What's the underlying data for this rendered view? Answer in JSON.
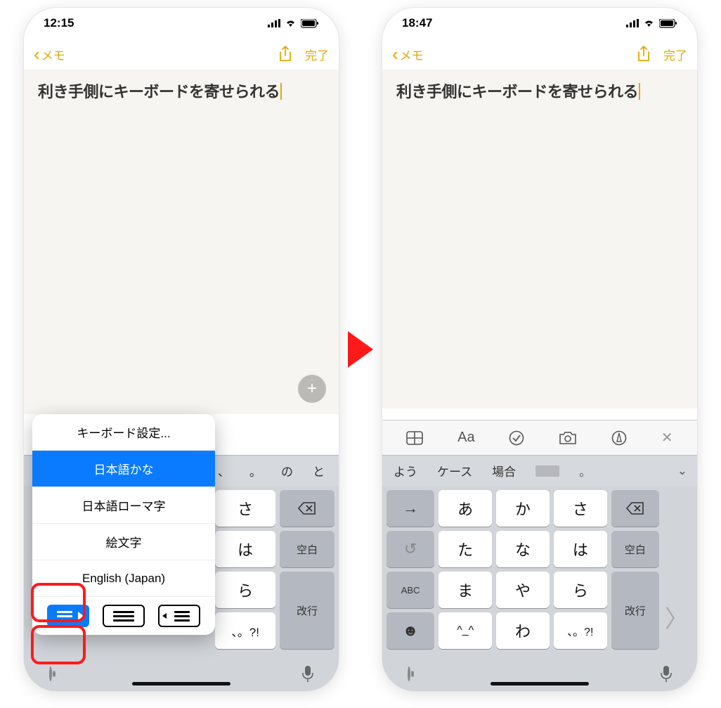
{
  "left": {
    "status": {
      "time": "12:15"
    },
    "nav": {
      "back": "メモ",
      "done": "完了"
    },
    "note": {
      "title": "利き手側にキーボードを寄せられる"
    },
    "popup": {
      "settings": "キーボード設定...",
      "items": [
        "日本語かな",
        "日本語ローマ字",
        "絵文字",
        "English (Japan)"
      ],
      "selected_index": 0
    },
    "suggestions": [
      "、",
      "。",
      "の",
      "と"
    ],
    "kb": {
      "rows": [
        [
          "さ"
        ],
        [
          "は"
        ],
        [
          "ら"
        ],
        [
          "、。?!"
        ]
      ],
      "space": "空白",
      "return": "改行"
    }
  },
  "right": {
    "status": {
      "time": "18:47"
    },
    "nav": {
      "back": "メモ",
      "done": "完了"
    },
    "note": {
      "title": "利き手側にキーボードを寄せられる"
    },
    "toolbar": {
      "aa": "Aa"
    },
    "suggestions": [
      "よう",
      "ケース",
      "場合"
    ],
    "kb": {
      "rows": [
        [
          "→",
          "あ",
          "か",
          "さ",
          "⌫"
        ],
        [
          "↺",
          "た",
          "な",
          "は",
          "空白"
        ],
        [
          "ABC",
          "ま",
          "や",
          "ら",
          "改行"
        ],
        [
          "☻",
          "^_^",
          "わ",
          "、。?!"
        ]
      ],
      "space": "空白",
      "return": "改行",
      "abc": "ABC"
    }
  }
}
